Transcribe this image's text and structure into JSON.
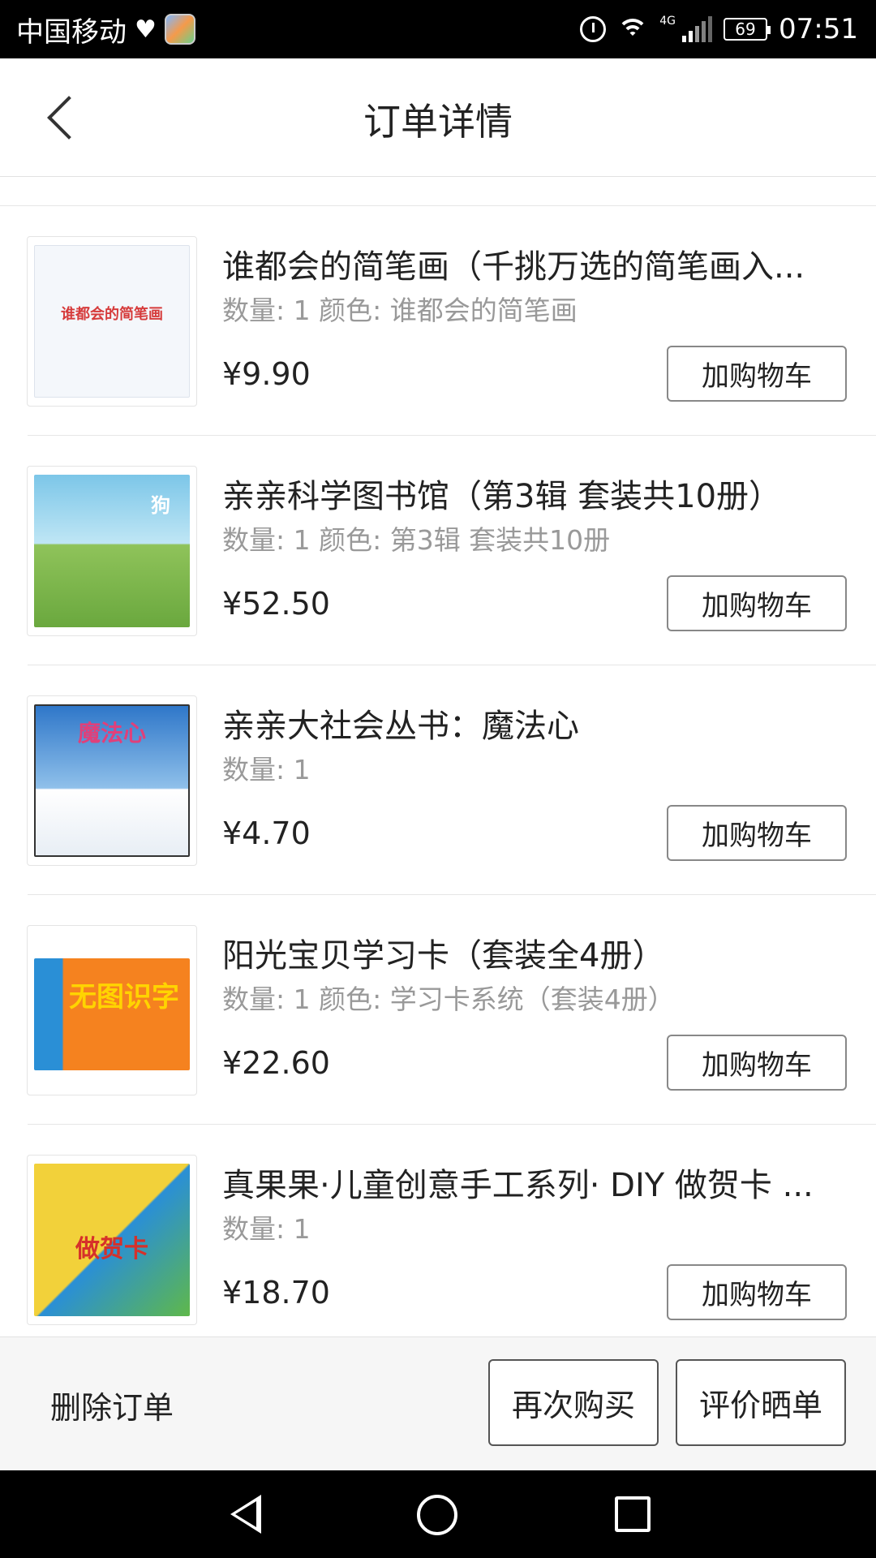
{
  "status_bar": {
    "carrier": "中国移动",
    "network": "4G",
    "battery": "69",
    "time": "07:51"
  },
  "header": {
    "title": "订单详情"
  },
  "items": [
    {
      "title": "谁都会的简笔画（千挑万选的简笔画入...",
      "meta": "数量: 1 颜色: 谁都会的简笔画",
      "price": "¥9.90",
      "button": "加购物车",
      "thumb_caption": "谁都会的简笔画",
      "thumb_colors": [
        "#f4f7fb",
        "#d63b3b"
      ]
    },
    {
      "title": "亲亲科学图书馆（第3辑 套装共10册）",
      "meta": "数量: 1 颜色: 第3辑 套装共10册",
      "price": "¥52.50",
      "button": "加购物车",
      "thumb_caption": "狗",
      "thumb_colors": [
        "#7cc6e8",
        "#8fc35a"
      ]
    },
    {
      "title": "亲亲大社会丛书：魔法心",
      "meta": "数量: 1",
      "price": "¥4.70",
      "button": "加购物车",
      "thumb_caption": "魔法心",
      "thumb_colors": [
        "#2f77c9",
        "#ffffff"
      ]
    },
    {
      "title": "阳光宝贝学习卡（套装全4册）",
      "meta": "数量: 1 颜色: 学习卡系统（套装4册）",
      "price": "¥22.60",
      "button": "加购物车",
      "thumb_caption": "无图识字",
      "thumb_colors": [
        "#f5821f",
        "#ffd400"
      ]
    },
    {
      "title": "真果果·儿童创意手工系列· DIY 做贺卡 ...",
      "meta": "数量: 1",
      "price": "¥18.70",
      "button": "加购物车",
      "thumb_caption": "做贺卡",
      "thumb_colors": [
        "#f2d13a",
        "#2a8fd6"
      ]
    }
  ],
  "bottom_bar": {
    "delete_label": "删除订单",
    "rebuy_label": "再次购买",
    "review_label": "评价晒单"
  }
}
